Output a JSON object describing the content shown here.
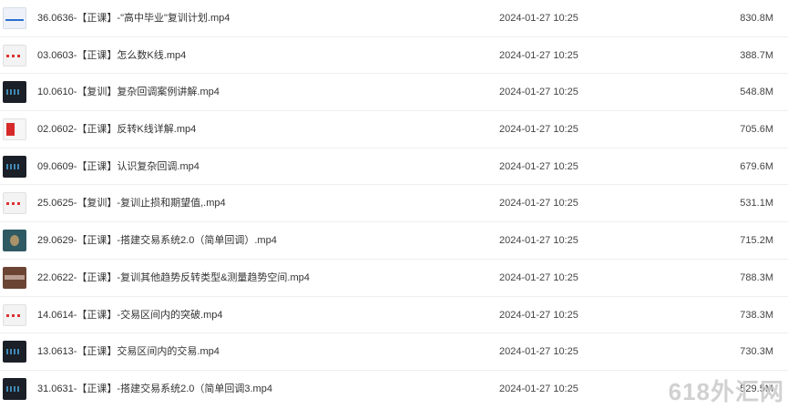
{
  "files": [
    {
      "name": "36.0636-【正课】-\"高中毕业\"复训计划.mp4",
      "date": "2024-01-27 10:25",
      "size": "830.8M",
      "thumb": "blue"
    },
    {
      "name": "03.0603-【正课】怎么数K线.mp4",
      "date": "2024-01-27 10:25",
      "size": "388.7M",
      "thumb": "light"
    },
    {
      "name": "10.0610-【复训】复杂回调案例讲解.mp4",
      "date": "2024-01-27 10:25",
      "size": "548.8M",
      "thumb": "dark"
    },
    {
      "name": "02.0602-【正课】反转K线详解.mp4",
      "date": "2024-01-27 10:25",
      "size": "705.6M",
      "thumb": "red"
    },
    {
      "name": "09.0609-【正课】认识复杂回调.mp4",
      "date": "2024-01-27 10:25",
      "size": "679.6M",
      "thumb": "dark"
    },
    {
      "name": "25.0625-【复训】-复训止损和期望值,.mp4",
      "date": "2024-01-27 10:25",
      "size": "531.1M",
      "thumb": "light"
    },
    {
      "name": "29.0629-【正课】-搭建交易系统2.0（简单回调）.mp4",
      "date": "2024-01-27 10:25",
      "size": "715.2M",
      "thumb": "teal"
    },
    {
      "name": "22.0622-【正课】-复训其他趋势反转类型&测量趋势空间.mp4",
      "date": "2024-01-27 10:25",
      "size": "788.3M",
      "thumb": "brown"
    },
    {
      "name": "14.0614-【正课】-交易区间内的突破.mp4",
      "date": "2024-01-27 10:25",
      "size": "738.3M",
      "thumb": "light"
    },
    {
      "name": "13.0613-【正课】交易区间内的交易.mp4",
      "date": "2024-01-27 10:25",
      "size": "730.3M",
      "thumb": "dark"
    },
    {
      "name": "31.0631-【正课】-搭建交易系统2.0（简单回调3.mp4",
      "date": "2024-01-27 10:25",
      "size": "529.5M",
      "thumb": "dark"
    }
  ],
  "watermark": "618外汇网"
}
